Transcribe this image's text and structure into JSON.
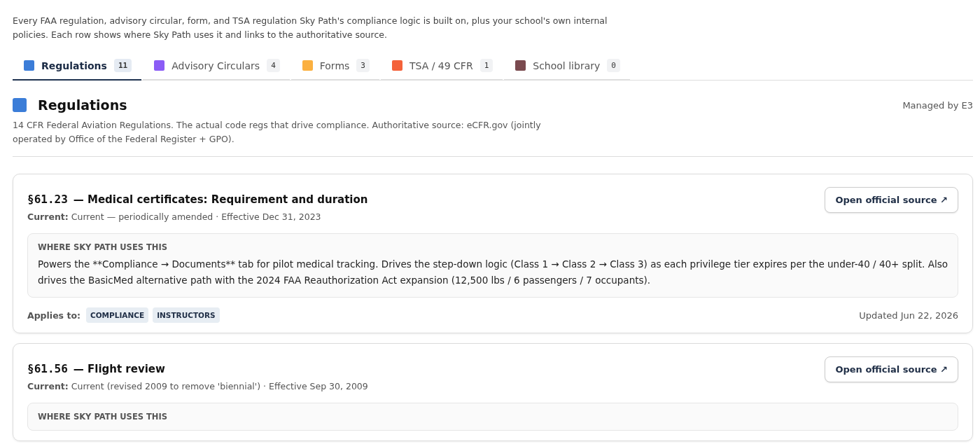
{
  "intro": "Every FAA regulation, advisory circular, form, and TSA regulation Sky Path's compliance logic is built on, plus your school's own internal policies. Each row shows where Sky Path uses it and links to the authoritative source.",
  "tabs": [
    {
      "label": "Regulations",
      "count": "11",
      "color": "#3b7dd8",
      "selected": true
    },
    {
      "label": "Advisory Circulars",
      "count": "4",
      "color": "#8b5cf6",
      "selected": false
    },
    {
      "label": "Forms",
      "count": "3",
      "color": "#fbb040",
      "selected": false
    },
    {
      "label": "TSA / 49 CFR",
      "count": "1",
      "color": "#f4623a",
      "selected": false
    },
    {
      "label": "School library",
      "count": "0",
      "color": "#7a4a4f",
      "selected": false
    }
  ],
  "section": {
    "title": "Regulations",
    "color": "#3b7dd8",
    "managed_by": "Managed by E3",
    "description": "14 CFR Federal Aviation Regulations. The actual code regs that drive compliance. Authoritative source: eCFR.gov (jointly operated by Office of the Federal Register + GPO)."
  },
  "cards": [
    {
      "code": "§61.23",
      "title": "— Medical certificates: Requirement and duration",
      "current": "**Current:** Current — periodically amended · Effective Dec 31, 2023",
      "button": "Open official source ↗",
      "uses_label": "WHERE SKY PATH USES THIS",
      "uses_text": "Powers the **Compliance → Documents** tab for pilot medical tracking. Drives the step-down logic (Class 1 → Class 2 → Class 3) as each privilege tier expires per the under-40 / 40+ split. Also drives the BasicMed alternative path with the 2024 FAA Reauthorization Act expansion (12,500 lbs / 6 passengers / 7 occupants).",
      "applies_label": "Applies to:",
      "tags": [
        "COMPLIANCE",
        "INSTRUCTORS"
      ],
      "updated": "Updated Jun 22, 2026"
    },
    {
      "code": "§61.56",
      "title": "— Flight review",
      "current": "**Current:** Current (revised 2009 to remove 'biennial') · Effective Sep 30, 2009",
      "button": "Open official source ↗",
      "uses_label": "WHERE SKY PATH USES THIS"
    }
  ]
}
